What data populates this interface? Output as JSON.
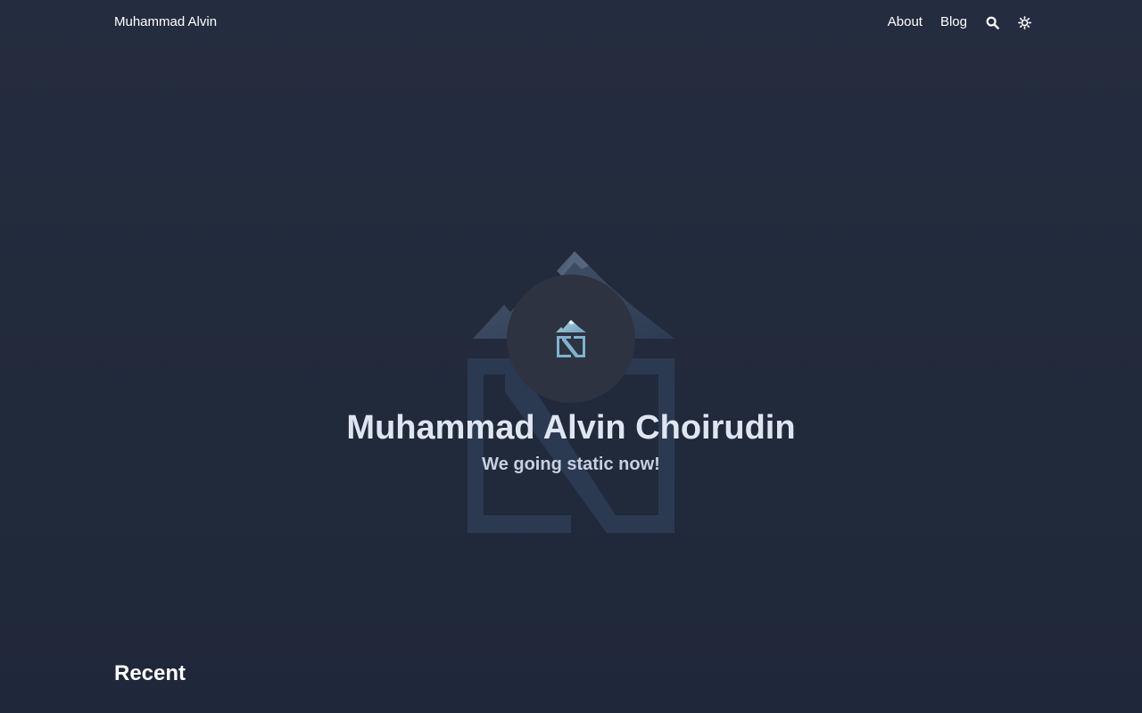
{
  "navbar": {
    "brand": "Muhammad Alvin",
    "links": [
      {
        "label": "About"
      },
      {
        "label": "Blog"
      }
    ],
    "icons": [
      "search-icon",
      "theme-toggle-icon"
    ]
  },
  "hero": {
    "title": "Muhammad Alvin Choirudin",
    "subtitle": "We going static now!",
    "logo_icon": "mountain-n-logo-icon"
  },
  "recent": {
    "heading": "Recent"
  },
  "colors": {
    "background": "#232c3e",
    "avatar_bg": "#2d3340",
    "title": "#dfe6f2",
    "subtitle": "#c6d0e0",
    "logo_accent": "#7fb3cc"
  }
}
